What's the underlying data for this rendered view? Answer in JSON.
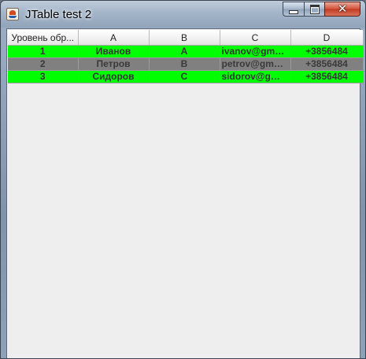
{
  "window": {
    "title": "JTable test 2",
    "close_glyph": "✕"
  },
  "table": {
    "columns": [
      "Уровень обр...",
      "A",
      "B",
      "C",
      "D"
    ],
    "rows": [
      {
        "cells": [
          "1",
          "Иванов",
          "A",
          "ivanov@gmail....",
          "+3856484"
        ],
        "color": "#00ff00"
      },
      {
        "cells": [
          "2",
          "Петров",
          "B",
          "petrov@gmail....",
          "+3856484"
        ],
        "color": "#808080"
      },
      {
        "cells": [
          "3",
          "Сидоров",
          "C",
          "sidorov@gma...",
          "+3856484"
        ],
        "color": "#00ff00"
      }
    ]
  },
  "icons": {
    "app": "java-cup-icon",
    "minimize": "minimize-icon",
    "maximize": "maximize-icon",
    "close": "close-icon"
  }
}
